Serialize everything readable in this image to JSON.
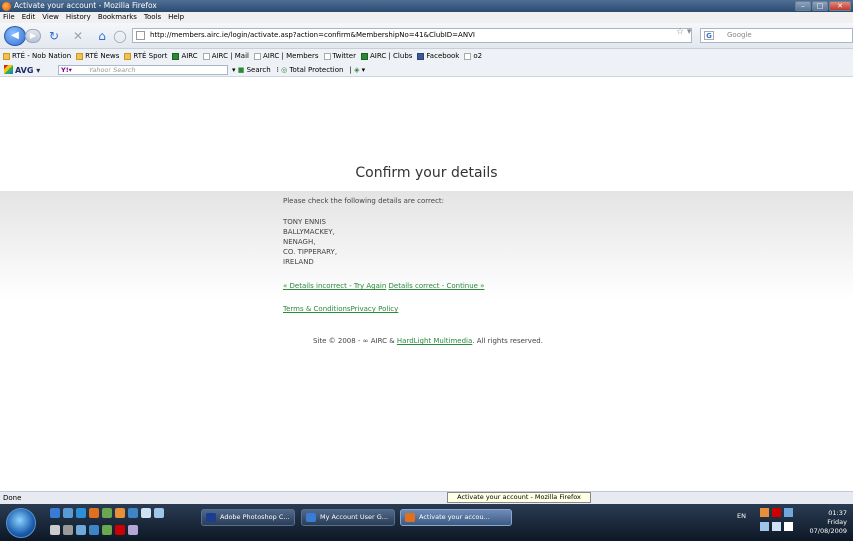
{
  "window": {
    "title": "Activate your account - Mozilla Firefox",
    "controls": [
      "–",
      "□",
      "✕"
    ]
  },
  "menu": [
    "File",
    "Edit",
    "View",
    "History",
    "Bookmarks",
    "Tools",
    "Help"
  ],
  "nav": {
    "url": "http://members.airc.ie/login/activate.asp?action=confirm&MembershipNo=41&ClubID=ANVI",
    "search_engine": "Google",
    "search_placeholder": "Google"
  },
  "bookmarks": [
    {
      "label": "RTÉ - Nob Nation",
      "icon": "folder"
    },
    {
      "label": "RTÉ News",
      "icon": "folder"
    },
    {
      "label": "RTÉ Sport",
      "icon": "folder"
    },
    {
      "label": "AIRC",
      "icon": "green"
    },
    {
      "label": "AIRC | Mail",
      "icon": "page"
    },
    {
      "label": "AIRC | Members",
      "icon": "page"
    },
    {
      "label": "Twitter",
      "icon": "page"
    },
    {
      "label": "AIRC | Clubs",
      "icon": "green"
    },
    {
      "label": "Facebook",
      "icon": "fb"
    },
    {
      "label": "o2",
      "icon": "page"
    }
  ],
  "avg": {
    "logo": "AVG",
    "search_placeholder": "Yahoo! Search",
    "search_button": "Search",
    "total_protection": "Total Protection"
  },
  "page": {
    "heading": "Confirm your details",
    "prompt": "Please check the following details are correct:",
    "address": [
      "TONY ENNIS",
      "BALLYMACKEY,",
      "NENAGH,",
      "CO. TIPPERARY,",
      "IRELAND"
    ],
    "link_incorrect": "« Details incorrect - Try Again",
    "link_correct": "Details correct - Continue »",
    "link_terms": "Terms & Conditions",
    "link_privacy": "Privacy Policy",
    "footer_prefix": "Site © 2008 - ∞ AIRC & ",
    "footer_link": "HardLight Multimedia",
    "footer_suffix": ". All rights reserved."
  },
  "status": {
    "text": "Done",
    "tooltip": "Activate your account - Mozilla Firefox"
  },
  "taskbar": {
    "tasks": [
      {
        "label": "Adobe Photoshop C...",
        "color": "#1b3d8f"
      },
      {
        "label": "My Account User G...",
        "color": "#3a7bd5"
      },
      {
        "label": "Activate your accou...",
        "color": "#e0701f"
      }
    ],
    "lang": "EN",
    "time": "01:37",
    "day": "Friday",
    "date": "07/08/2009"
  },
  "colors": {
    "link": "#2a8a3a",
    "heading": "#333333"
  }
}
